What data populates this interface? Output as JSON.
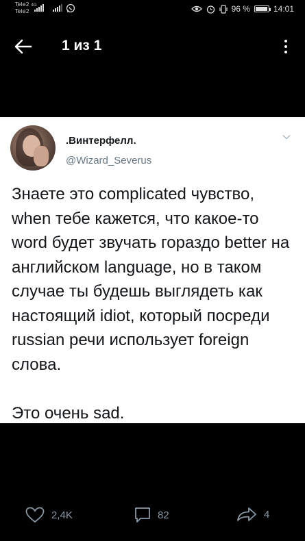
{
  "statusbar": {
    "carrier1": "Tele2",
    "carrier2": "Tele2",
    "net1": "4G",
    "battery_text": "96 %",
    "battery_level": 0.96,
    "time": "14:01"
  },
  "topbar": {
    "title": "1 из 1"
  },
  "tweet": {
    "display_name": ".Винтерфелл.",
    "handle": "@Wizard_Severus",
    "text": "Знаете это complicated чувство, when тебе кажется, что какое-то word будет звучать гораздо better на английском language, но в таком случае ты будешь выглядеть как настоящий idiot, который посреди russian речи использует foreign слова.\n\nЭто очень sad."
  },
  "actions": {
    "likes": "2,4K",
    "replies": "82",
    "retweets": "4"
  }
}
